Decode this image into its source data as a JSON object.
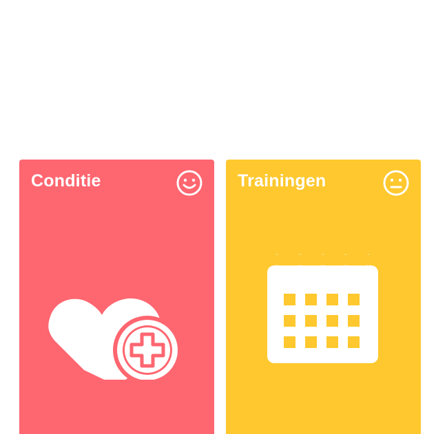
{
  "cards": [
    {
      "title": "Conditie",
      "mood_icon": "smiley-happy-icon",
      "illustration_icon": "heart-plus-icon",
      "color": "#fe6670"
    },
    {
      "title": "Trainingen",
      "mood_icon": "smiley-neutral-icon",
      "illustration_icon": "calendar-icon",
      "color": "#fec82e"
    }
  ]
}
